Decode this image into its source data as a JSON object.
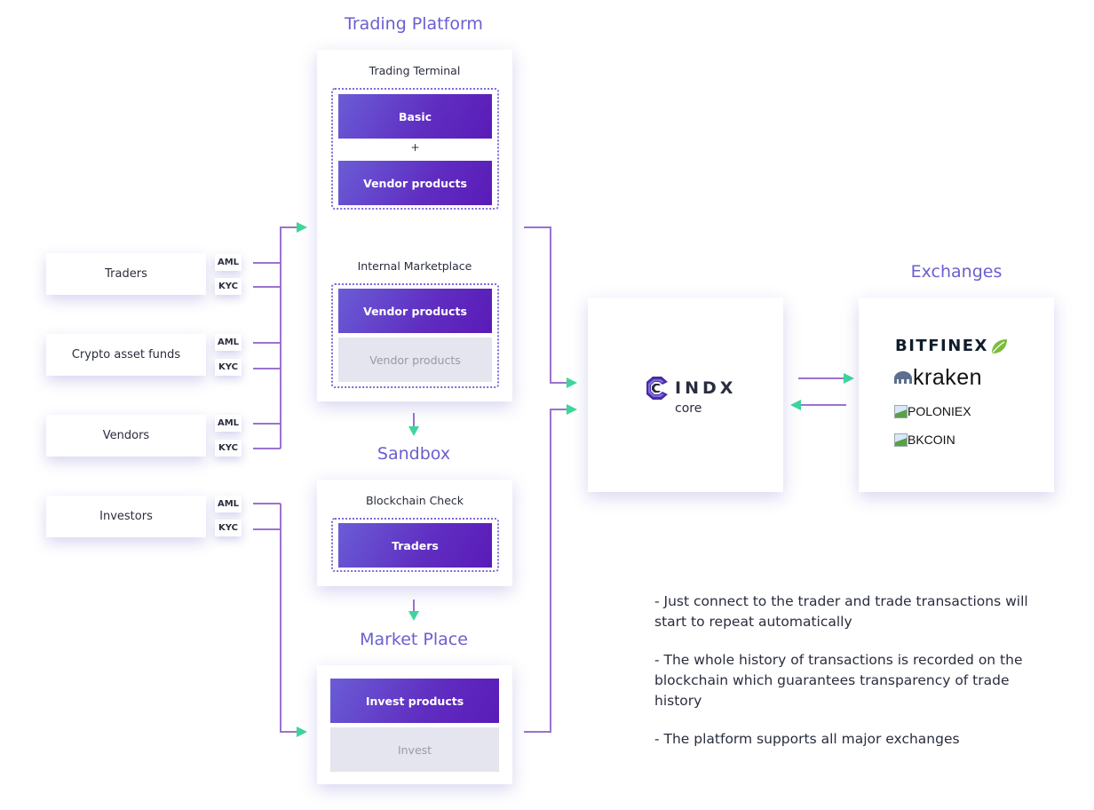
{
  "sections": {
    "trading_platform": "Trading Platform",
    "sandbox": "Sandbox",
    "market_place": "Market Place",
    "exchanges": "Exchanges"
  },
  "trading_terminal": {
    "heading": "Trading Terminal",
    "basic": "Basic",
    "plus": "+",
    "vendor_products": "Vendor products"
  },
  "internal_marketplace": {
    "heading": "Internal Marketplace",
    "vendor_products_active": "Vendor products",
    "vendor_products_inactive": "Vendor products"
  },
  "blockchain_check": {
    "heading": "Blockchain Check",
    "traders": "Traders"
  },
  "market_place_card": {
    "invest_products": "Invest products",
    "invest": "Invest"
  },
  "actors": [
    {
      "label": "Traders",
      "tags": [
        "AML",
        "KYC"
      ]
    },
    {
      "label": "Crypto asset funds",
      "tags": [
        "AML",
        "KYC"
      ]
    },
    {
      "label": "Vendors",
      "tags": [
        "AML",
        "KYC"
      ]
    },
    {
      "label": "Investors",
      "tags": [
        "AML",
        "KYC"
      ]
    }
  ],
  "core": {
    "brand": "INDX",
    "subtitle": "core"
  },
  "exchanges_list": [
    "BITFINEX",
    "kraken",
    "POLONIEX",
    "BKCOIN"
  ],
  "notes": [
    "- Just connect to the trader and trade transactions will start to repeat automatically",
    "- The whole history of transactions is recorded on the blockchain which guarantees transparency of trade history",
    "- The platform supports all major exchanges"
  ],
  "colors": {
    "accent_purple": "#6a5fd0",
    "line_purple": "#9b72cf",
    "arrow_green": "#3dd69a",
    "button_gradient_start": "#6a5dd6",
    "button_gradient_end": "#5a1bb8",
    "inactive_grey": "#e4e5ee"
  }
}
